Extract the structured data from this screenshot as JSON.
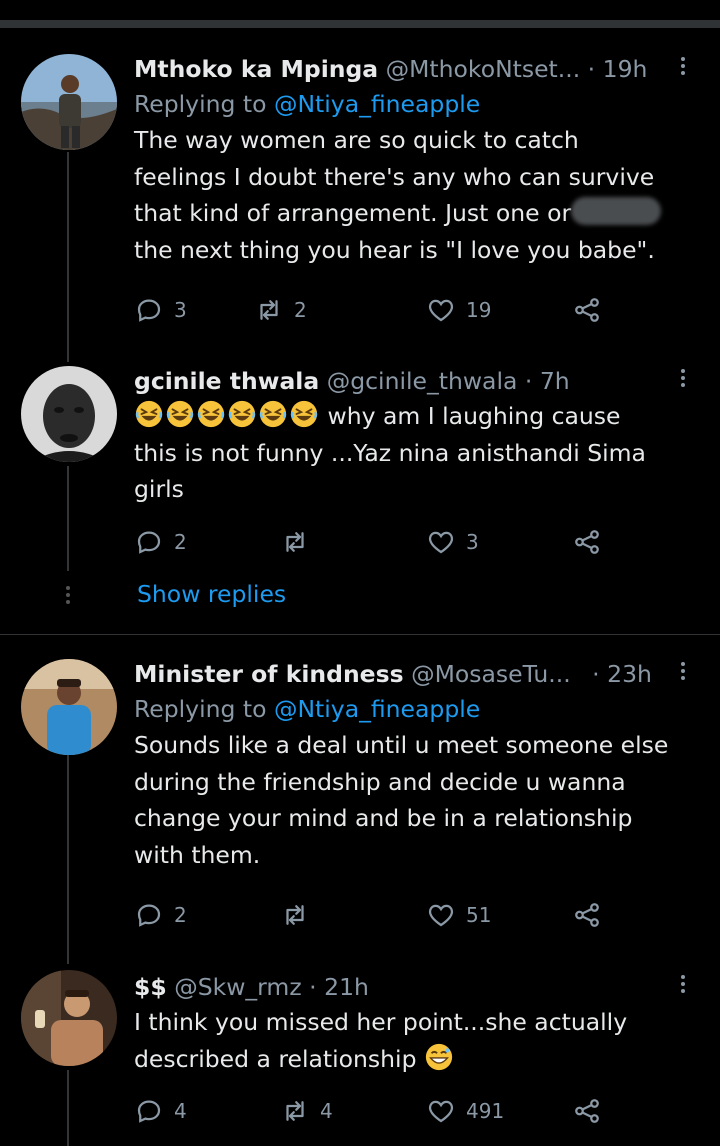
{
  "tweets": [
    {
      "name": "Mthoko ka Mpinga",
      "handle": "@MthokoNtset...",
      "dot": "·",
      "time": "19h",
      "replying_prefix": "Replying to ",
      "replying_to": "@Ntiya_fineapple",
      "lines": [
        "The way women are so quick to catch",
        "feelings I doubt there's any who can survive",
        "that kind of arrangement. Just one or",
        "the next thing you hear is \"I love you babe\"."
      ],
      "replies": "3",
      "retweets": "2",
      "likes": "19"
    },
    {
      "name": "gcinile thwala",
      "handle": "@gcinile_thwala",
      "dot": "·",
      "time": "7h",
      "emoji_count": 6,
      "lines": [
        "why am I laughing cause",
        "this is not funny ...Yaz nina anisthandi Sima",
        "girls"
      ],
      "replies": "2",
      "retweets": "",
      "likes": "3"
    },
    {
      "name": "Minister of kindness",
      "handle": "@MosaseTu...",
      "dot": "·",
      "time": "23h",
      "replying_prefix": "Replying to ",
      "replying_to": "@Ntiya_fineapple",
      "lines": [
        "Sounds like a deal until u meet someone else",
        "during the friendship and decide u wanna",
        "change your mind and be in a relationship",
        "with them."
      ],
      "replies": "2",
      "retweets": "",
      "likes": "51"
    },
    {
      "name": "$$",
      "handle": "@Skw_rmz",
      "dot": "·",
      "time": "21h",
      "lines": [
        "I think you missed her point...she actually",
        "described a relationship"
      ],
      "replies": "4",
      "retweets": "4",
      "likes": "491"
    }
  ],
  "show_replies": "Show replies",
  "icons": {
    "reply": "reply-icon",
    "retweet": "retweet-icon",
    "like": "heart-icon",
    "share": "share-icon",
    "more": "more-vertical-icon",
    "laugh": "rolling-on-floor-laughing-emoji",
    "sweat": "grinning-sweat-emoji"
  },
  "colors": {
    "background": "#000000",
    "text": "#e7e9ea",
    "muted": "#8b98a5",
    "accent": "#1d9bf0"
  }
}
